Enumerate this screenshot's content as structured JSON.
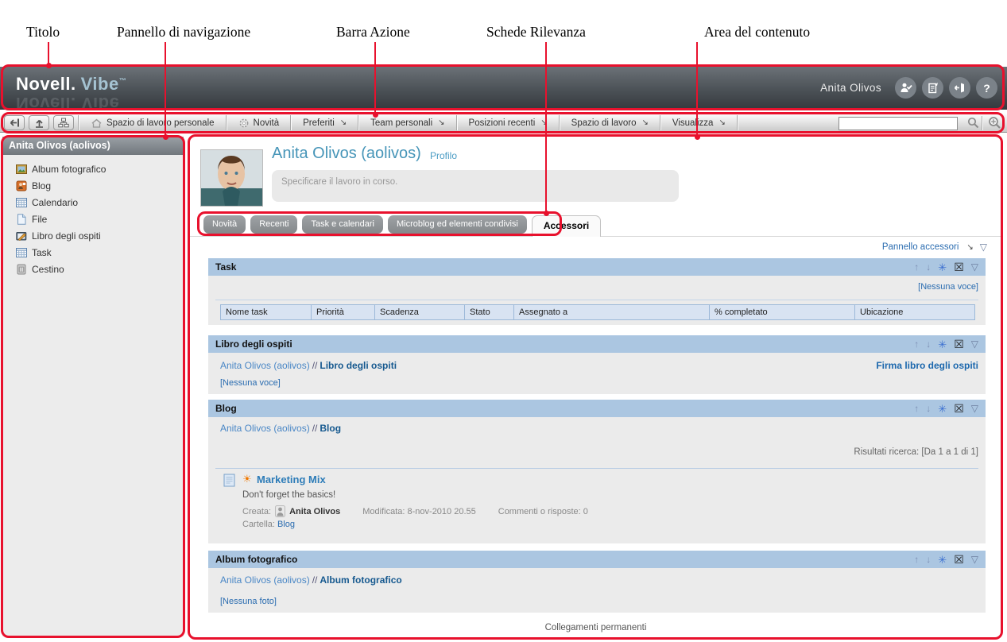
{
  "annotations": {
    "labels": [
      {
        "text": "Titolo"
      },
      {
        "text": "Pannello di navigazione"
      },
      {
        "text": "Barra Azione"
      },
      {
        "text": "Schede Rilevanza"
      },
      {
        "text": "Area del contenuto"
      }
    ],
    "line_color": "#e8112d"
  },
  "glyphs": {
    "dropdown": "↘",
    "up": "↑",
    "down": "↓",
    "gear": "✳",
    "close": "☒",
    "collapse": "▽",
    "sun": "☀",
    "help": "?"
  },
  "header": {
    "logo_primary": "Novell.",
    "logo_secondary": "Vibe",
    "logo_tm": "™",
    "logo_reflection": "Novell. Vibe",
    "user_name": "Anita Olivos"
  },
  "action_bar": {
    "items": [
      {
        "label": "Spazio di lavoro personale"
      },
      {
        "label": "Novità"
      },
      {
        "label": "Preferiti"
      },
      {
        "label": "Team personali"
      },
      {
        "label": "Posizioni recenti"
      },
      {
        "label": "Spazio di lavoro"
      },
      {
        "label": "Visualizza"
      }
    ],
    "search_value": ""
  },
  "sidebar": {
    "title": "Anita Olivos (aolivos)",
    "items": [
      {
        "label": "Album fotografico",
        "icon": "photo-album-icon"
      },
      {
        "label": "Blog",
        "icon": "blog-icon"
      },
      {
        "label": "Calendario",
        "icon": "calendar-icon"
      },
      {
        "label": "File",
        "icon": "file-icon"
      },
      {
        "label": "Libro degli ospiti",
        "icon": "guestbook-icon"
      },
      {
        "label": "Task",
        "icon": "task-icon"
      },
      {
        "label": "Cestino",
        "icon": "trash-icon"
      }
    ]
  },
  "profile": {
    "name": "Anita Olivos (aolivos)",
    "profile_link": "Profilo",
    "status_placeholder": "Specificare il lavoro in corso."
  },
  "tabs": {
    "items": [
      {
        "label": "Novità"
      },
      {
        "label": "Recenti"
      },
      {
        "label": "Task e calendari"
      },
      {
        "label": "Microblog ed elementi condivisi"
      },
      {
        "label": "Accessori"
      }
    ]
  },
  "accessory_bar": {
    "link": "Pannello accessori"
  },
  "panels": {
    "task": {
      "title": "Task",
      "empty_link": "[Nessuna voce]",
      "columns": [
        "Nome task",
        "Priorità",
        "Scadenza",
        "Stato",
        "Assegnato a",
        "% completato",
        "Ubicazione"
      ]
    },
    "guestbook": {
      "title": "Libro degli ospiti",
      "breadcrumb_user": "Anita Olivos (aolivos)",
      "breadcrumb_sep": "//",
      "breadcrumb_page": "Libro degli ospiti",
      "action_link": "Firma libro degli ospiti",
      "empty_link": "[Nessuna voce]"
    },
    "blog": {
      "title": "Blog",
      "breadcrumb_user": "Anita Olivos (aolivos)",
      "breadcrumb_sep": "//",
      "breadcrumb_page": "Blog",
      "results": "Risultati ricerca: [Da 1 a 1 di 1]",
      "entry": {
        "title": "Marketing Mix",
        "body": "Don't forget the basics!",
        "created_label": "Creata:",
        "author": "Anita Olivos",
        "modified": "Modificata: 8-nov-2010 20.55",
        "comments": "Commenti o risposte: 0",
        "folder_label": "Cartella:",
        "folder_link": "Blog"
      }
    },
    "album": {
      "title": "Album fotografico",
      "breadcrumb_user": "Anita Olivos (aolivos)",
      "breadcrumb_sep": "//",
      "breadcrumb_page": "Album fotografico",
      "empty_link": "[Nessuna foto]"
    }
  },
  "footer": {
    "permalink": "Collegamenti permanenti"
  }
}
